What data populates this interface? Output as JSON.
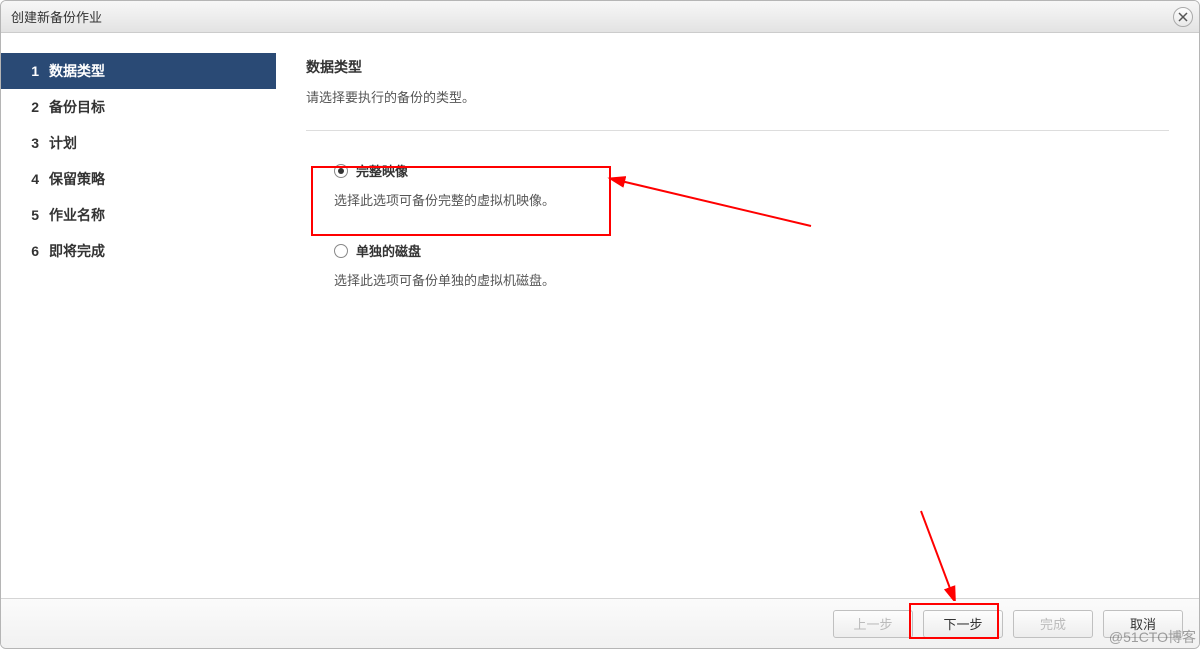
{
  "dialog": {
    "title": "创建新备份作业"
  },
  "sidebar": {
    "steps": [
      {
        "num": "1",
        "label": "数据类型",
        "active": true
      },
      {
        "num": "2",
        "label": "备份目标",
        "active": false
      },
      {
        "num": "3",
        "label": "计划",
        "active": false
      },
      {
        "num": "4",
        "label": "保留策略",
        "active": false
      },
      {
        "num": "5",
        "label": "作业名称",
        "active": false
      },
      {
        "num": "6",
        "label": "即将完成",
        "active": false
      }
    ]
  },
  "main": {
    "heading": "数据类型",
    "subheading": "请选择要执行的备份的类型。",
    "options": [
      {
        "label": "完整映像",
        "description": "选择此选项可备份完整的虚拟机映像。",
        "selected": true
      },
      {
        "label": "单独的磁盘",
        "description": "选择此选项可备份单独的虚拟机磁盘。",
        "selected": false
      }
    ]
  },
  "footer": {
    "prev": "上一步",
    "next": "下一步",
    "finish": "完成",
    "cancel": "取消"
  },
  "watermark": "@51CTO博客"
}
